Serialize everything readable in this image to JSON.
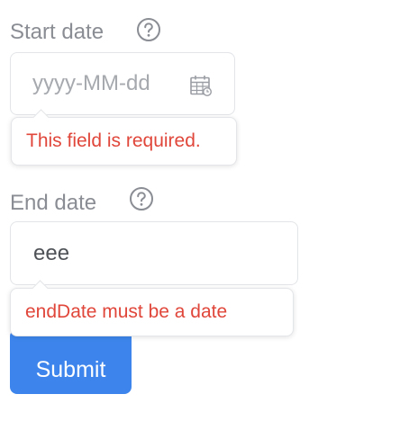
{
  "form": {
    "start_date": {
      "label": "Start date",
      "help_icon": "question-circle-icon",
      "placeholder": "yyyy-MM-dd",
      "value": "",
      "picker_icon": "calendar-icon",
      "error": "This field is required."
    },
    "end_date": {
      "label": "End date",
      "help_icon": "question-circle-icon",
      "placeholder": "",
      "value": "eee",
      "error": "endDate must be a date"
    },
    "submit_label": "Submit"
  },
  "colors": {
    "label": "#8a8d93",
    "placeholder": "#a6a9ae",
    "input_text": "#4f5257",
    "input_border": "#e2e4e8",
    "error": "#e0463a",
    "primary": "#3d85ec"
  }
}
